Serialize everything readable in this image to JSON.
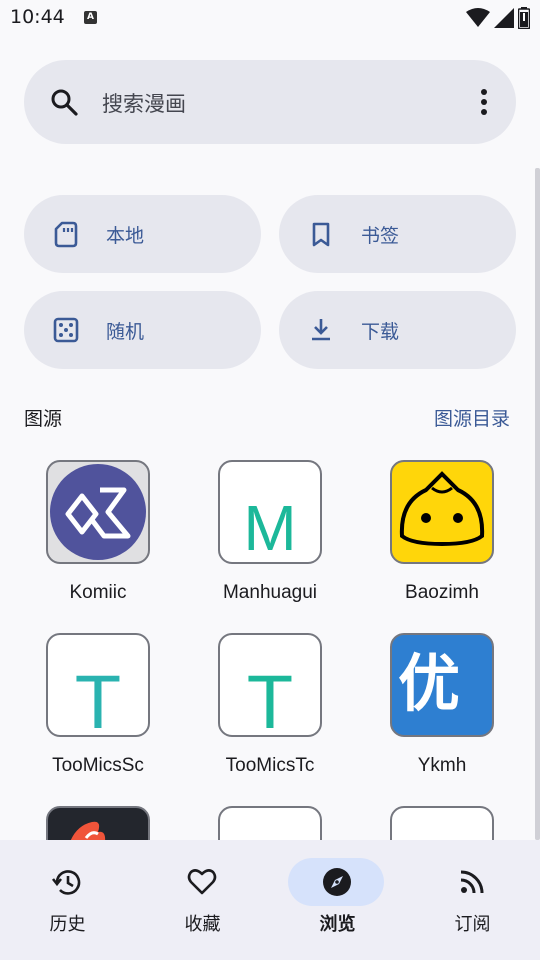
{
  "status": {
    "time": "10:44",
    "notification_glyph": "A"
  },
  "search": {
    "placeholder": "搜索漫画"
  },
  "quick_actions": [
    {
      "label": "本地",
      "icon": "sd-card-icon"
    },
    {
      "label": "书签",
      "icon": "bookmark-icon"
    },
    {
      "label": "随机",
      "icon": "dice-icon"
    },
    {
      "label": "下载",
      "icon": "download-icon"
    }
  ],
  "sources_section": {
    "title": "图源",
    "link": "图源目录"
  },
  "sources": [
    {
      "name": "Komiic"
    },
    {
      "name": "Manhuagui",
      "glyph": "M"
    },
    {
      "name": "Baozimh"
    },
    {
      "name": "TooMicsSc",
      "glyph": "T"
    },
    {
      "name": "TooMicsTc",
      "glyph": "T"
    },
    {
      "name": "Ykmh",
      "glyph": "优"
    }
  ],
  "nav": {
    "items": [
      {
        "label": "历史",
        "icon": "history-icon"
      },
      {
        "label": "收藏",
        "icon": "heart-icon"
      },
      {
        "label": "浏览",
        "icon": "compass-icon",
        "active": true
      },
      {
        "label": "订阅",
        "icon": "rss-icon"
      }
    ]
  },
  "colors": {
    "accent": "#3b5a96",
    "surface": "#e6e7ee",
    "teal": "#1cb89a",
    "baozi_yellow": "#ffd60a",
    "komiic_purple": "#50539c",
    "ykmh_blue": "#2e7fd1"
  }
}
